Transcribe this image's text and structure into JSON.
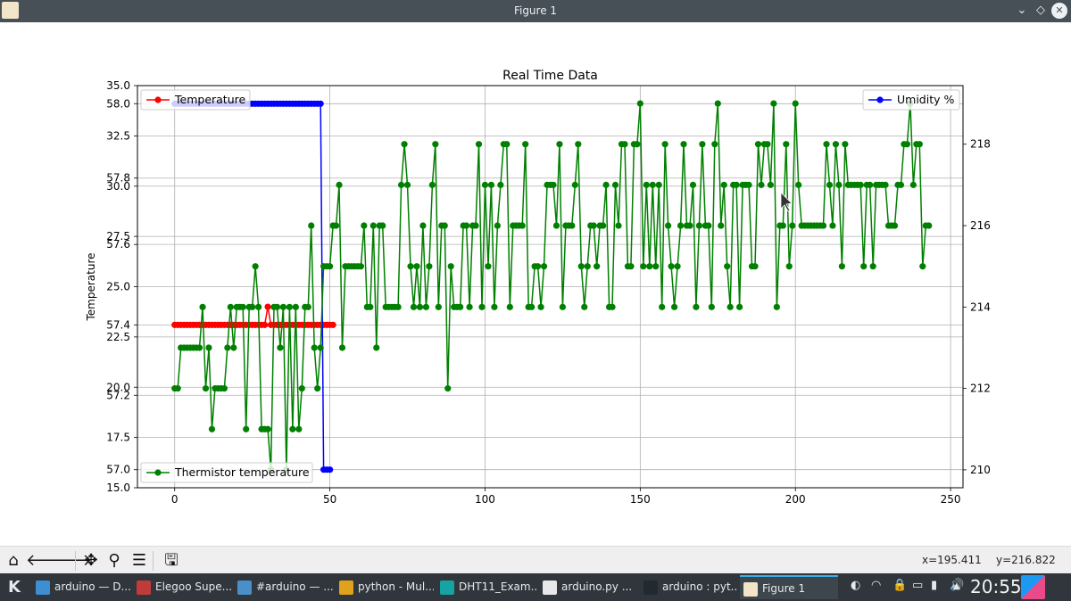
{
  "window": {
    "title": "Figure 1",
    "icon": "figure-app-icon",
    "controls": [
      "chevron-down-icon",
      "diamond-icon",
      "close-icon"
    ]
  },
  "chart_data": {
    "type": "line",
    "title": "Real Time Data",
    "ylabel": "Temperature",
    "x_ticks": [
      "0",
      "50",
      "100",
      "150",
      "200",
      "250"
    ],
    "xlim": [
      -12,
      254
    ],
    "left_ticks": [
      "35.0",
      "58.0",
      "32.5",
      "57.8",
      "30.0",
      "27.5",
      "57.6",
      "25.0",
      "57.4",
      "22.5",
      "20.0",
      "57.2",
      "17.5",
      "57.0",
      "15.0"
    ],
    "left_tick_values": [
      35.0,
      34.1,
      32.5,
      30.4,
      30.0,
      27.5,
      27.1,
      25.0,
      23.1,
      22.5,
      20.0,
      19.6,
      17.5,
      15.9,
      15.0
    ],
    "ylim_left": [
      15,
      35
    ],
    "right_ticks": [
      "210",
      "212",
      "214",
      "216",
      "218"
    ],
    "ylim_right": [
      209.56,
      219.44
    ],
    "grid": true,
    "legend": [
      {
        "label": "Temperature",
        "color": "#ff0000",
        "position": "top-left"
      },
      {
        "label": "Umidity %",
        "color": "#0000ff",
        "position": "top-right"
      },
      {
        "label": "Thermistor temperature",
        "color": "#008000",
        "position": "bottom-left"
      }
    ],
    "series": [
      {
        "name": "Temperature",
        "color": "#ff0000",
        "axis": "left",
        "x": [
          0,
          1,
          2,
          3,
          4,
          5,
          6,
          7,
          8,
          9,
          10,
          11,
          12,
          13,
          14,
          15,
          16,
          17,
          18,
          19,
          20,
          21,
          22,
          23,
          24,
          25,
          26,
          27,
          28,
          29,
          30,
          31,
          32,
          33,
          34,
          35,
          36,
          37,
          38,
          39,
          40,
          41,
          42,
          43,
          44,
          45,
          46,
          47,
          48,
          49,
          50,
          51
        ],
        "values": [
          23.1,
          23.1,
          23.1,
          23.1,
          23.1,
          23.1,
          23.1,
          23.1,
          23.1,
          23.1,
          23.1,
          23.1,
          23.1,
          23.1,
          23.1,
          23.1,
          23.1,
          23.1,
          23.1,
          23.1,
          23.1,
          23.1,
          23.1,
          23.1,
          23.1,
          23.1,
          23.1,
          23.1,
          23.1,
          23.1,
          24.0,
          23.1,
          23.1,
          23.1,
          23.1,
          23.1,
          23.1,
          23.1,
          23.1,
          23.1,
          23.1,
          23.1,
          23.1,
          23.1,
          23.1,
          23.1,
          23.1,
          23.1,
          23.1,
          23.1,
          23.1,
          23.1
        ]
      },
      {
        "name": "Umidity %",
        "color": "#0000ff",
        "axis": "left",
        "x": [
          0,
          1,
          2,
          3,
          4,
          5,
          6,
          7,
          8,
          9,
          10,
          11,
          12,
          13,
          14,
          15,
          16,
          17,
          18,
          19,
          20,
          21,
          22,
          23,
          24,
          25,
          26,
          27,
          28,
          29,
          30,
          31,
          32,
          33,
          34,
          35,
          36,
          37,
          38,
          39,
          40,
          41,
          42,
          43,
          44,
          45,
          46,
          47,
          48,
          49,
          50
        ],
        "values": [
          34.1,
          34.1,
          34.1,
          34.1,
          34.1,
          34.1,
          34.1,
          34.1,
          34.1,
          34.1,
          34.1,
          34.1,
          34.1,
          34.1,
          34.1,
          34.1,
          34.1,
          34.1,
          34.1,
          34.1,
          34.1,
          34.1,
          34.1,
          34.1,
          34.1,
          34.1,
          34.1,
          34.1,
          34.1,
          34.1,
          34.1,
          34.1,
          34.1,
          34.1,
          34.1,
          34.1,
          34.1,
          34.1,
          34.1,
          34.1,
          34.1,
          34.1,
          34.1,
          34.1,
          34.1,
          34.1,
          34.1,
          34.1,
          15.9,
          15.9,
          15.9
        ]
      },
      {
        "name": "Thermistor temperature",
        "color": "#008000",
        "axis": "right",
        "x": [
          0,
          1,
          2,
          3,
          4,
          5,
          6,
          7,
          8,
          9,
          10,
          11,
          12,
          13,
          14,
          15,
          16,
          17,
          18,
          19,
          20,
          21,
          22,
          23,
          24,
          25,
          26,
          27,
          28,
          29,
          30,
          31,
          32,
          33,
          34,
          35,
          36,
          37,
          38,
          39,
          40,
          41,
          42,
          43,
          44,
          45,
          46,
          47,
          48,
          49,
          50,
          51,
          52,
          53,
          54,
          55,
          56,
          57,
          58,
          59,
          60,
          61,
          62,
          63,
          64,
          65,
          66,
          67,
          68,
          69,
          70,
          71,
          72,
          73,
          74,
          75,
          76,
          77,
          78,
          79,
          80,
          81,
          82,
          83,
          84,
          85,
          86,
          87,
          88,
          89,
          90,
          91,
          92,
          93,
          94,
          95,
          96,
          97,
          98,
          99,
          100,
          101,
          102,
          103,
          104,
          105,
          106,
          107,
          108,
          109,
          110,
          111,
          112,
          113,
          114,
          115,
          116,
          117,
          118,
          119,
          120,
          121,
          122,
          123,
          124,
          125,
          126,
          127,
          128,
          129,
          130,
          131,
          132,
          133,
          134,
          135,
          136,
          137,
          138,
          139,
          140,
          141,
          142,
          143,
          144,
          145,
          146,
          147,
          148,
          149,
          150,
          151,
          152,
          153,
          154,
          155,
          156,
          157,
          158,
          159,
          160,
          161,
          162,
          163,
          164,
          165,
          166,
          167,
          168,
          169,
          170,
          171,
          172,
          173,
          174,
          175,
          176,
          177,
          178,
          179,
          180,
          181,
          182,
          183,
          184,
          185,
          186,
          187,
          188,
          189,
          190,
          191,
          192,
          193,
          194,
          195,
          196,
          197,
          198,
          199,
          200,
          201,
          202,
          203,
          204,
          205,
          206,
          207,
          208,
          209,
          210,
          211,
          212,
          213,
          214,
          215,
          216,
          217,
          218,
          219,
          220,
          221,
          222,
          223,
          224,
          225,
          226,
          227,
          228,
          229,
          230,
          231,
          232,
          233,
          234,
          235,
          236,
          237,
          238,
          239,
          240,
          241,
          242,
          243
        ],
        "values": [
          212,
          212,
          213,
          213,
          213,
          213,
          213,
          213,
          213,
          214,
          212,
          213,
          211,
          212,
          212,
          212,
          212,
          213,
          214,
          213,
          214,
          214,
          214,
          211,
          214,
          214,
          215,
          214,
          211,
          211,
          211,
          210,
          214,
          214,
          213,
          214,
          210,
          214,
          211,
          214,
          211,
          212,
          214,
          214,
          216,
          213,
          212,
          213,
          215,
          215,
          215,
          216,
          216,
          217,
          213,
          215,
          215,
          215,
          215,
          215,
          215,
          216,
          214,
          214,
          216,
          213,
          216,
          216,
          214,
          214,
          214,
          214,
          214,
          217,
          218,
          217,
          215,
          214,
          215,
          214,
          216,
          214,
          215,
          217,
          218,
          214,
          216,
          216,
          212,
          215,
          214,
          214,
          214,
          216,
          216,
          214,
          216,
          216,
          218,
          214,
          217,
          215,
          217,
          214,
          216,
          217,
          218,
          218,
          214,
          216,
          216,
          216,
          216,
          218,
          214,
          214,
          215,
          215,
          214,
          215,
          217,
          217,
          217,
          216,
          218,
          214,
          216,
          216,
          216,
          217,
          218,
          215,
          214,
          215,
          216,
          216,
          215,
          216,
          216,
          217,
          214,
          214,
          217,
          216,
          218,
          218,
          215,
          215,
          218,
          218,
          219,
          215,
          217,
          215,
          217,
          215,
          217,
          214,
          218,
          216,
          215,
          214,
          215,
          216,
          218,
          216,
          216,
          217,
          214,
          216,
          218,
          216,
          216,
          214,
          218,
          219,
          216,
          217,
          215,
          214,
          217,
          217,
          214,
          217,
          217,
          217,
          215,
          215,
          218,
          217,
          218,
          218,
          217,
          219,
          214,
          216,
          216,
          218,
          215,
          216,
          219,
          217,
          216,
          216,
          216,
          216,
          216,
          216,
          216,
          216,
          218,
          217,
          216,
          218,
          217,
          215,
          218,
          217,
          217,
          217,
          217,
          217,
          215,
          217,
          217,
          215,
          217,
          217,
          217,
          217,
          216,
          216,
          216,
          217,
          217,
          218,
          218,
          219,
          217,
          218,
          218,
          215,
          216,
          216
        ]
      }
    ]
  },
  "toolbar": {
    "buttons": [
      {
        "name": "home-icon",
        "glyph": "⌂"
      },
      {
        "name": "back-arrow-icon",
        "glyph": "🡐"
      },
      {
        "name": "forward-arrow-icon",
        "glyph": "🡒"
      },
      {
        "name": "pan-move-icon",
        "glyph": "✥"
      },
      {
        "name": "zoom-magnifier-icon",
        "glyph": "⚲"
      },
      {
        "name": "subplots-sliders-icon",
        "glyph": "☰"
      },
      {
        "name": "save-floppy-icon",
        "glyph": "🖫"
      }
    ],
    "x_readout": "x=195.411",
    "y_readout": "y=216.822"
  },
  "taskbar": {
    "tasks": [
      {
        "label": "arduino — D...",
        "icon_color": "#3d8fd1",
        "icon": "folder-icon"
      },
      {
        "label": "Elegoo Supe...",
        "icon_color": "#c23b3b",
        "icon": "pdf-icon"
      },
      {
        "label": "#arduino — ...",
        "icon_color": "#4a90c8",
        "icon": "chat-icon"
      },
      {
        "label": "python - Mul...",
        "icon_color": "#e0a21c",
        "icon": "chrome-icon"
      },
      {
        "label": "DHT11_Exam...",
        "icon_color": "#16a3a3",
        "icon": "arduino-icon"
      },
      {
        "label": "arduino.py ...",
        "icon_color": "#e8e8e8",
        "icon": "text-file-icon"
      },
      {
        "label": "arduino : pyt...",
        "icon_color": "#222a30",
        "icon": "terminal-icon"
      },
      {
        "label": "Figure 1",
        "icon_color": "#f3e6c8",
        "icon": "figure-app-icon",
        "active": true
      }
    ],
    "tray": [
      "network-manager-icon",
      "wifi-icon",
      "lock-icon",
      "storage-icon",
      "battery-icon",
      "volume-icon",
      "tray-expand-icon"
    ],
    "clock": "20:55"
  }
}
